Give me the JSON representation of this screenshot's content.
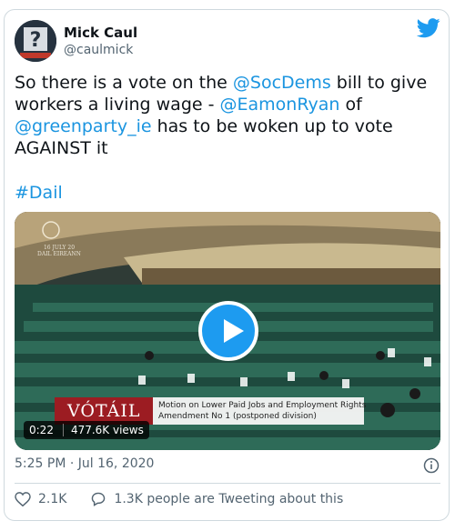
{
  "author": {
    "name": "Mick Caul",
    "handle": "@caulmick",
    "avatar_icon": "profile-avatar"
  },
  "tweet": {
    "line1_prefix": "So there is a vote on the ",
    "line1_mention": "@SocDems",
    "line1_suffix": " bill to give",
    "line2_prefix": "workers a living wage - ",
    "line2_mention": "@EamonRyan",
    "line2_suffix": " of",
    "line3_mention": "@greenparty_ie",
    "line3_suffix": " has to be woken up to vote",
    "line4": "AGAINST it",
    "hashtag": "#Dail"
  },
  "media": {
    "overlay_date": "16 JULY 20",
    "overlay_channel": "DAIL EIREANN",
    "lower_third_title": "VÓTÁIL",
    "lower_third_line1": "Motion on Lower Paid Jobs and Employment Rights",
    "lower_third_line2": "Amendment No 1  (postponed division)",
    "duration": "0:22",
    "views": "477.6K views",
    "play_icon": "play-button"
  },
  "footer": {
    "timestamp": "5:25 PM · Jul 16, 2020",
    "likes": "2.1K",
    "replies_text": "1.3K people are Tweeting about this"
  },
  "colors": {
    "link": "#1b95e0",
    "twitter_blue": "#1d9bf0",
    "muted": "#536471",
    "votail_red": "#9c1c22"
  }
}
